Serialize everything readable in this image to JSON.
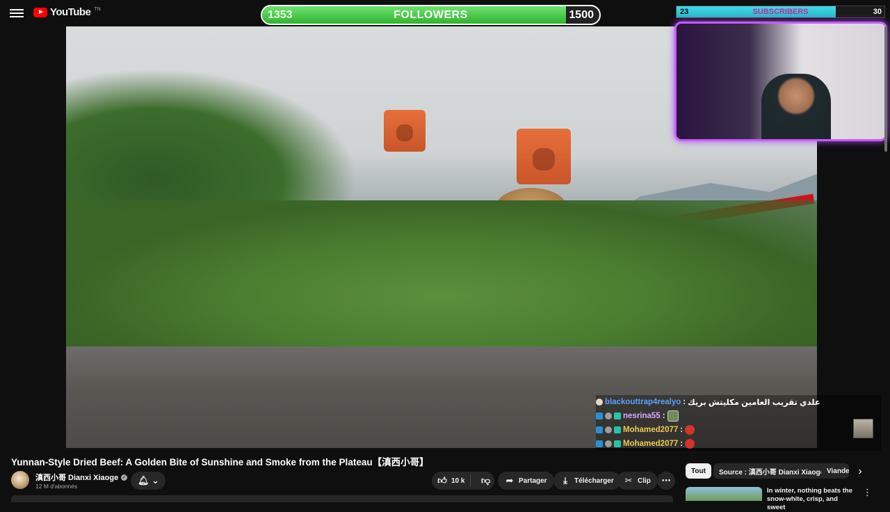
{
  "header": {
    "logo_text": "YouTube",
    "logo_sup": "TN"
  },
  "followers_goal": {
    "current": "1353",
    "label": "FOLLOWERS",
    "goal": "1500",
    "progress": 0.902
  },
  "subscribers_goal": {
    "current": "23",
    "label": "SUBSCRIBERS",
    "goal": "30",
    "progress": 0.767
  },
  "chat": [
    {
      "user": "blackouttrap4realyo",
      "user_color": "#5aa0ff",
      "separator": ":",
      "message": "علدي تقريب العامين مكليتش بريك"
    },
    {
      "user": "nesrina55",
      "user_color": "#d8a6ff",
      "separator": ":",
      "message": ""
    },
    {
      "user": "Mohamed2077",
      "user_color": "#f2c94c",
      "separator": ":",
      "message": ""
    },
    {
      "user": "Mohamed2077",
      "user_color": "#f2c94c",
      "separator": ":",
      "message": ""
    }
  ],
  "video": {
    "title": "Yunnan-Style Dried Beef: A Golden Bite of Sunshine and Smoke from the Plateau【滇西小哥】",
    "channel_name": "滇西小哥 Dianxi Xiaoge",
    "subscriber_count": "12 M d'abonnés",
    "like_count": "10 k",
    "share_label": "Partager",
    "download_label": "Télécharger",
    "clip_label": "Clip"
  },
  "chips": [
    "Tout",
    "Source : 滇西小哥 Dianxi Xiaoge",
    "Viande"
  ],
  "recommendation": {
    "title": "In winter, nothing beats the snow-white, crisp, and sweet"
  },
  "colors": {
    "accent_red": "#ff0000",
    "followers_green": "#2fb32f",
    "subs_cyan": "#2bb7c8",
    "cam_border": "#c65bff"
  }
}
